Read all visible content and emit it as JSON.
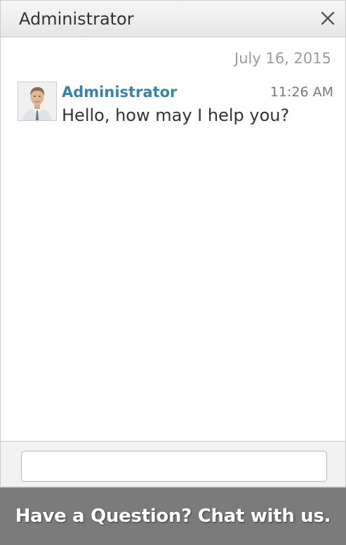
{
  "header": {
    "title": "Administrator",
    "close_icon": "close-icon"
  },
  "conversation": {
    "date": "July 16, 2015",
    "messages": [
      {
        "sender": "Administrator",
        "time": "11:26 AM",
        "text": "Hello, how may I help you?",
        "avatar_icon": "user-avatar-photo"
      }
    ]
  },
  "composer": {
    "value": "",
    "placeholder": ""
  },
  "banner": {
    "label": "Have a Question? Chat with us."
  },
  "colors": {
    "sender_name": "#3a83a8",
    "banner_background": "#7b7b7b",
    "header_background": "#eeeeee"
  }
}
